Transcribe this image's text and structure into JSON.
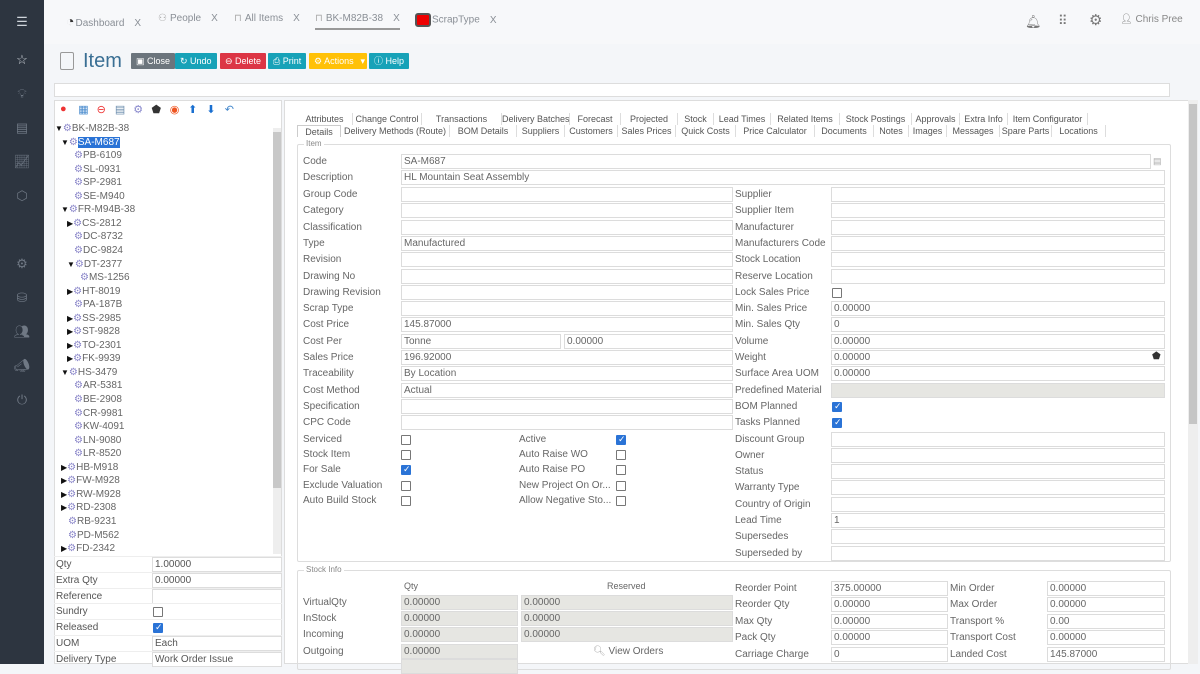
{
  "colors": {
    "sidebar": "#2d3540",
    "close": "#6c757d",
    "undo": "#17a2b8",
    "delete": "#dc3545",
    "print": "#17a2b8",
    "actions": "#ffc107",
    "help": "#17a2b8",
    "selection": "#2a73d6"
  },
  "sidebar": {
    "icons": [
      "menu-icon",
      "star-icon",
      "lightbulb-icon",
      "id-card-icon",
      "chart-icon",
      "cube-icon",
      "gear-icon",
      "database-icon",
      "people-icon",
      "megaphone-icon",
      "signout-icon"
    ]
  },
  "tabs": [
    {
      "label": "Dashboard",
      "icon": "gauge-icon"
    },
    {
      "label": "People",
      "icon": "people-icon"
    },
    {
      "label": "All Items",
      "icon": "item-icon"
    },
    {
      "label": "BK-M82B-38",
      "icon": "item-icon",
      "active": true
    },
    {
      "label": "ScrapType",
      "icon": "red-square-icon"
    }
  ],
  "tab_close": "X",
  "user": {
    "name": "Chris Pree"
  },
  "page": {
    "title": "Item"
  },
  "toolbar": {
    "close": "Close",
    "undo": "Undo",
    "delete": "Delete",
    "print": "Print",
    "actions": "Actions",
    "help": "Help"
  },
  "tree_toolbar": [
    "add-icon",
    "calendar-icon",
    "remove-icon",
    "document-icon",
    "gear-icon",
    "weight-icon",
    "target-icon",
    "arrow-up-icon",
    "arrow-down-icon",
    "undo-icon"
  ],
  "tree": [
    {
      "label": "BK-M82B-38",
      "level": 0,
      "exp": "open"
    },
    {
      "label": "SA-M687",
      "level": 1,
      "exp": "open",
      "selected": true
    },
    {
      "label": "PB-6109",
      "level": 2
    },
    {
      "label": "SL-0931",
      "level": 2
    },
    {
      "label": "SP-2981",
      "level": 2
    },
    {
      "label": "SE-M940",
      "level": 2
    },
    {
      "label": "FR-M94B-38",
      "level": 1,
      "exp": "open"
    },
    {
      "label": "CS-2812",
      "level": 2,
      "exp": "closed"
    },
    {
      "label": "DC-8732",
      "level": 2
    },
    {
      "label": "DC-9824",
      "level": 2
    },
    {
      "label": "DT-2377",
      "level": 2,
      "exp": "open"
    },
    {
      "label": "MS-1256",
      "level": 3
    },
    {
      "label": "HT-8019",
      "level": 2,
      "exp": "closed"
    },
    {
      "label": "PA-187B",
      "level": 2
    },
    {
      "label": "SS-2985",
      "level": 2,
      "exp": "closed"
    },
    {
      "label": "ST-9828",
      "level": 2,
      "exp": "closed"
    },
    {
      "label": "TO-2301",
      "level": 2,
      "exp": "closed"
    },
    {
      "label": "FK-9939",
      "level": 2,
      "exp": "closed"
    },
    {
      "label": "HS-3479",
      "level": 1,
      "exp": "open"
    },
    {
      "label": "AR-5381",
      "level": 2
    },
    {
      "label": "BE-2908",
      "level": 2
    },
    {
      "label": "CR-9981",
      "level": 2
    },
    {
      "label": "KW-4091",
      "level": 2
    },
    {
      "label": "LN-9080",
      "level": 2
    },
    {
      "label": "LR-8520",
      "level": 2
    },
    {
      "label": "HB-M918",
      "level": 1,
      "exp": "closed"
    },
    {
      "label": "FW-M928",
      "level": 1,
      "exp": "closed"
    },
    {
      "label": "RW-M928",
      "level": 1,
      "exp": "closed"
    },
    {
      "label": "RD-2308",
      "level": 1,
      "exp": "closed"
    },
    {
      "label": "RB-9231",
      "level": 1
    },
    {
      "label": "PD-M562",
      "level": 1
    },
    {
      "label": "FD-2342",
      "level": 1,
      "exp": "closed"
    }
  ],
  "props": [
    {
      "label": "Qty",
      "value": "1.00000"
    },
    {
      "label": "Extra Qty",
      "value": "0.00000"
    },
    {
      "label": "Reference",
      "value": ""
    },
    {
      "label": "Sundry",
      "check": false
    },
    {
      "label": "Released",
      "check": true
    },
    {
      "label": "UOM",
      "value": "Each"
    },
    {
      "label": "Delivery Type",
      "value": "Work Order Issue"
    }
  ],
  "tabs_row1": [
    "Attributes",
    "Change Control",
    "Transactions",
    "Delivery Batches",
    "Forecast",
    "Projected",
    "Stock",
    "Lead Times",
    "Related Items",
    "Stock Postings",
    "Approvals",
    "Extra Info",
    "Item Configurator"
  ],
  "tabs_row2": [
    "Details",
    "Delivery Methods (Route)",
    "BOM Details",
    "Suppliers",
    "Customers",
    "Sales Prices",
    "Quick Costs",
    "Price Calculator",
    "Documents",
    "Notes",
    "Images",
    "Messages",
    "Spare Parts",
    "Locations"
  ],
  "item_legend": "Item",
  "code": {
    "label": "Code",
    "value": "SA-M687"
  },
  "description": {
    "label": "Description",
    "value": "HL Mountain Seat Assembly"
  },
  "left_fields": [
    {
      "label": "Group Code",
      "value": ""
    },
    {
      "label": "Category",
      "value": ""
    },
    {
      "label": "Classification",
      "value": ""
    },
    {
      "label": "Type",
      "value": "Manufactured"
    },
    {
      "label": "Revision",
      "value": ""
    },
    {
      "label": "Drawing No",
      "value": ""
    },
    {
      "label": "Drawing Revision",
      "value": ""
    },
    {
      "label": "Scrap Type",
      "value": ""
    },
    {
      "label": "Cost Price",
      "value": "145.87000"
    },
    {
      "label": "Cost Per",
      "value": "Tonne",
      "value2": "0.00000"
    },
    {
      "label": "Sales Price",
      "value": "196.92000"
    },
    {
      "label": "Traceability",
      "value": "By Location"
    },
    {
      "label": "Cost Method",
      "value": "Actual"
    },
    {
      "label": "Specification",
      "value": ""
    },
    {
      "label": "CPC Code",
      "value": ""
    }
  ],
  "checks": [
    {
      "label": "Serviced",
      "check": false,
      "label2": "Active",
      "check2": true
    },
    {
      "label": "Stock Item",
      "check": false,
      "label2": "Auto Raise WO",
      "check2": false
    },
    {
      "label": "For Sale",
      "check": true,
      "label2": "Auto Raise PO",
      "check2": false
    },
    {
      "label": "Exclude Valuation",
      "check": false,
      "label2": "New Project On Or...",
      "check2": false
    },
    {
      "label": "Auto Build Stock",
      "check": false,
      "label2": "Allow Negative Sto...",
      "check2": false
    }
  ],
  "right_fields": [
    {
      "label": "Supplier",
      "value": ""
    },
    {
      "label": "Supplier Item",
      "value": ""
    },
    {
      "label": "Manufacturer",
      "value": ""
    },
    {
      "label": "Manufacturers Code",
      "value": ""
    },
    {
      "label": "Stock Location",
      "value": ""
    },
    {
      "label": "Reserve Location",
      "value": ""
    },
    {
      "label": "Lock Sales Price",
      "check": false
    },
    {
      "label": "Min. Sales Price",
      "value": "0.00000"
    },
    {
      "label": "Min. Sales Qty",
      "value": "0"
    },
    {
      "label": "Volume",
      "value": "0.00000"
    },
    {
      "label": "Weight",
      "value": "0.00000"
    },
    {
      "label": "Surface Area UOM",
      "value": "0.00000"
    },
    {
      "label": "Predefined Material",
      "value": "",
      "ro": true
    },
    {
      "label": "BOM Planned",
      "check": true
    },
    {
      "label": "Tasks Planned",
      "check": true
    },
    {
      "label": "Discount Group",
      "value": ""
    },
    {
      "label": "Owner",
      "value": ""
    },
    {
      "label": "Status",
      "value": ""
    },
    {
      "label": "Warranty Type",
      "value": ""
    },
    {
      "label": "Country of Origin",
      "value": ""
    },
    {
      "label": "Lead Time",
      "value": "1"
    },
    {
      "label": "Supersedes",
      "value": ""
    },
    {
      "label": "Superseded by",
      "value": ""
    }
  ],
  "stock": {
    "legend": "Stock Info",
    "qty_header": "Qty",
    "reserved_header": "Reserved",
    "view_orders": "View Orders",
    "rows": [
      {
        "label": "VirtualQty",
        "qty": "0.00000",
        "reserved": "0.00000"
      },
      {
        "label": "InStock",
        "qty": "0.00000",
        "reserved": "0.00000"
      },
      {
        "label": "Incoming",
        "qty": "0.00000",
        "reserved": "0.00000"
      },
      {
        "label": "Outgoing",
        "qty": "0.00000"
      }
    ],
    "mid": [
      {
        "label": "Reorder Point",
        "value": "375.00000"
      },
      {
        "label": "Reorder Qty",
        "value": "0.00000"
      },
      {
        "label": "Max Qty",
        "value": "0.00000"
      },
      {
        "label": "Pack Qty",
        "value": "0.00000"
      },
      {
        "label": "Carriage Charge",
        "value": "0"
      }
    ],
    "right": [
      {
        "label": "Min Order",
        "value": "0.00000"
      },
      {
        "label": "Max Order",
        "value": "0.00000"
      },
      {
        "label": "Transport %",
        "value": "0.00"
      },
      {
        "label": "Transport Cost",
        "value": "0.00000"
      },
      {
        "label": "Landed Cost",
        "value": "145.87000"
      }
    ]
  }
}
